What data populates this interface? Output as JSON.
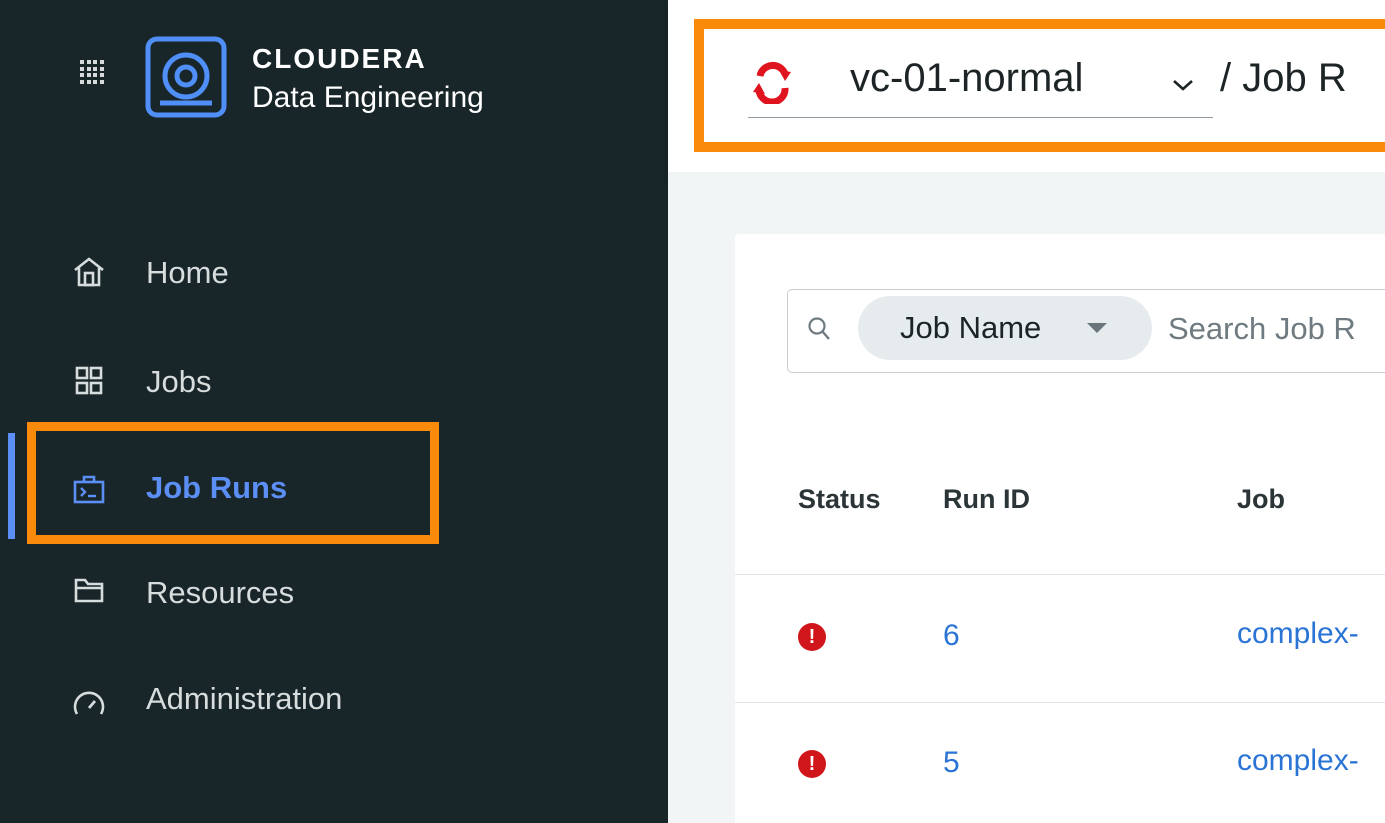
{
  "brand": {
    "company": "CLOUDERA",
    "product": "Data Engineering"
  },
  "sidebar": {
    "items": [
      {
        "label": "Home",
        "icon": "home-icon",
        "active": false
      },
      {
        "label": "Jobs",
        "icon": "jobs-icon",
        "active": false
      },
      {
        "label": "Job Runs",
        "icon": "job-runs-icon",
        "active": true
      },
      {
        "label": "Resources",
        "icon": "folder-icon",
        "active": false
      },
      {
        "label": "Administration",
        "icon": "gauge-icon",
        "active": false
      }
    ]
  },
  "header": {
    "virtual_cluster": "vc-01-normal",
    "breadcrumb": "/ Job R"
  },
  "search": {
    "filter_label": "Job Name",
    "placeholder": "Search Job R"
  },
  "table": {
    "columns": [
      "Status",
      "Run ID",
      "Job"
    ],
    "rows": [
      {
        "status": "!",
        "run_id": "6",
        "job": "complex-"
      },
      {
        "status": "!",
        "run_id": "5",
        "job": "complex-"
      }
    ]
  },
  "colors": {
    "sidebar_bg": "#182529",
    "accent": "#5b8ff5",
    "highlight": "#fa8a0a",
    "error": "#d0151b",
    "link": "#2a74d6"
  }
}
